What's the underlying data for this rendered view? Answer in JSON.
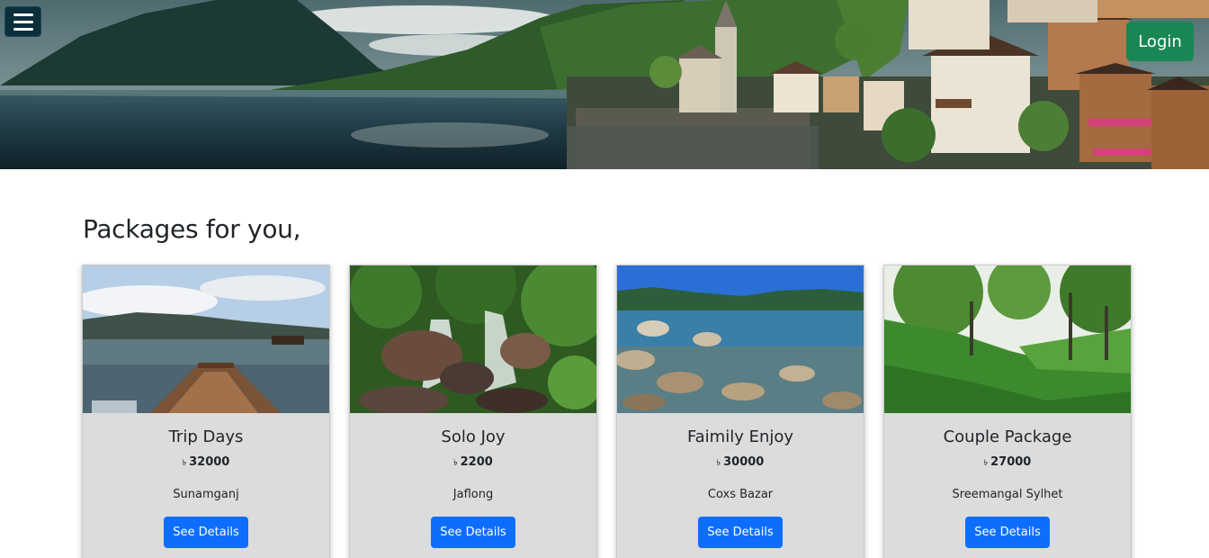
{
  "header": {
    "menu_icon": "hamburger-icon",
    "login_label": "Login",
    "login_color": "#198754"
  },
  "section": {
    "title": "Packages for you,"
  },
  "packages": [
    {
      "title": "Trip Days",
      "currency": "৳",
      "price": "32000",
      "place": "Sunamganj",
      "button": "See Details"
    },
    {
      "title": "Solo Joy",
      "currency": "৳",
      "price": "2200",
      "place": "Jaflong",
      "button": "See Details"
    },
    {
      "title": "Faimily Enjoy",
      "currency": "৳",
      "price": "30000",
      "place": "Coxs Bazar",
      "button": "See Details"
    },
    {
      "title": "Couple Package",
      "currency": "৳",
      "price": "27000",
      "place": "Sreemangal Sylhet",
      "button": "See Details"
    }
  ],
  "colors": {
    "primary_button": "#0d6efd",
    "card_background": "#dcdcdc"
  }
}
